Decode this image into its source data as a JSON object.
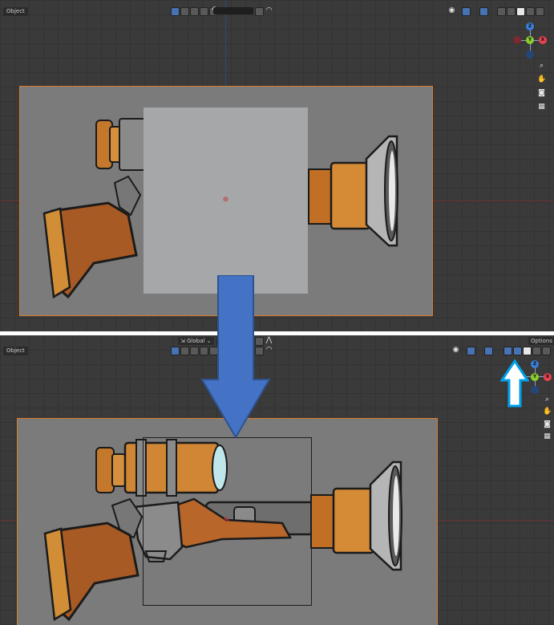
{
  "top_view": {
    "mode_label": "Object"
  },
  "bottom_view": {
    "mode_label": "Object",
    "transform_orientation": "Global",
    "options_label": "Options"
  },
  "gizmo_axes": {
    "z": "Z",
    "y": "Y",
    "x": "X"
  },
  "colors": {
    "viewport_bg": "#3a3a3a",
    "camera_bg": "#7b7b7b",
    "selection_outline": "#d77c2c",
    "plane_fill": "#a5a7a9",
    "arrow_blue": "#4472c4",
    "axis_x": "#e8434f",
    "axis_y": "#8ccd2c",
    "axis_z": "#3a7fd8"
  }
}
